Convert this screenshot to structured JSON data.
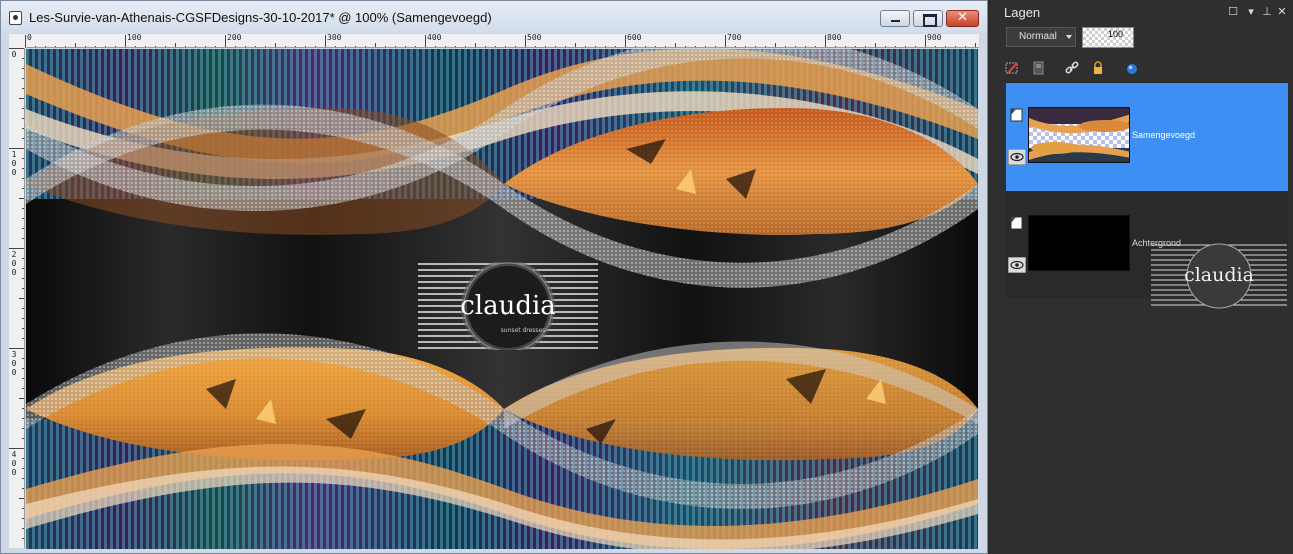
{
  "document": {
    "title": "Les-Survie-van-Athenais-CGSFDesigns-30-10-2017* @ 100% (Samengevoegd)",
    "window_buttons": {
      "close_glyph": "✕"
    }
  },
  "ruler": {
    "top_labels": [
      "0",
      "100",
      "200",
      "300",
      "400",
      "500",
      "600",
      "700",
      "800",
      "900"
    ],
    "left_labels": [
      "0",
      "100",
      "200",
      "300",
      "400"
    ]
  },
  "watermark": {
    "text": "claudia",
    "subtext": "sunset dresses"
  },
  "layers_panel": {
    "title": "Lagen",
    "blend_mode": "Normaal",
    "opacity": "100",
    "layers": [
      {
        "name": "Samengevoegd",
        "selected": true
      },
      {
        "name": "Achtergrond",
        "selected": false
      }
    ],
    "drag_ghost_text": "claudia"
  },
  "colors": {
    "selection": "#3d8ff4",
    "accent_orange": "#e07a1f",
    "titlebar": "#d2ddeb"
  }
}
